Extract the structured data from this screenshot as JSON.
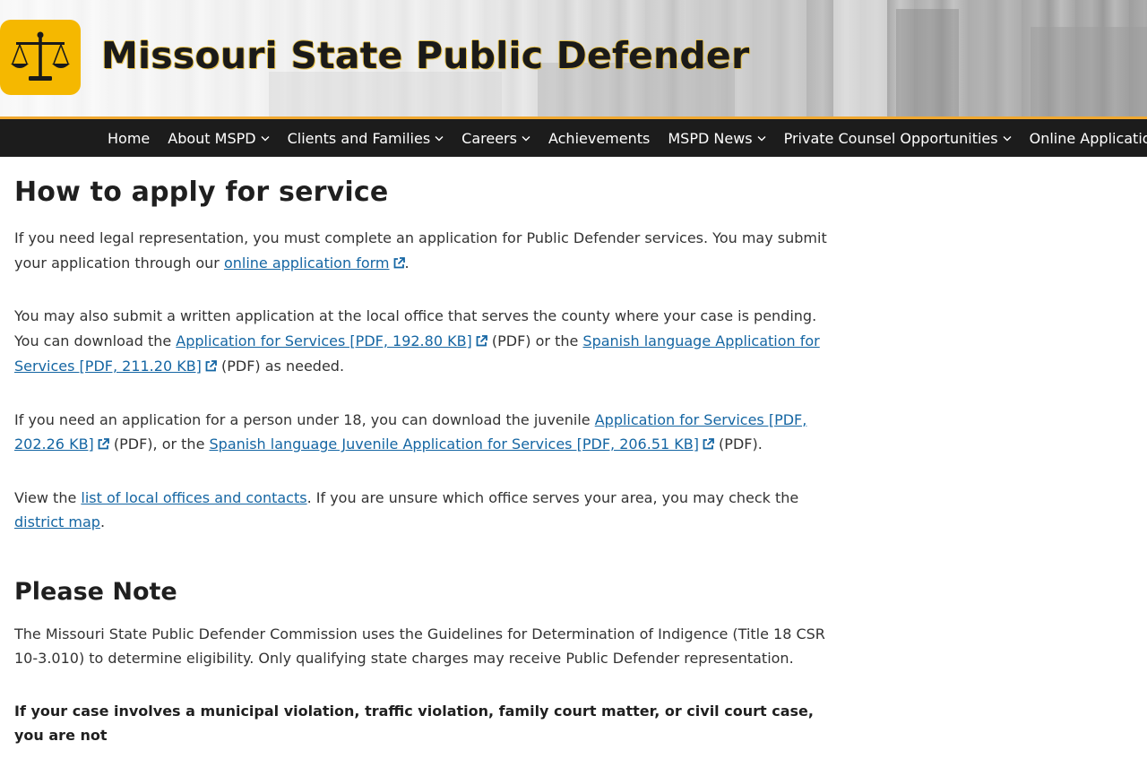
{
  "header": {
    "site_title": "Missouri State Public Defender",
    "brand_color": "#f5b800",
    "accent_color": "#f0a830",
    "logo_icon": "scales-of-justice-icon"
  },
  "nav": {
    "items": [
      {
        "label": "Home",
        "has_dropdown": false
      },
      {
        "label": "About MSPD",
        "has_dropdown": true
      },
      {
        "label": "Clients and Families",
        "has_dropdown": true
      },
      {
        "label": "Careers",
        "has_dropdown": true
      },
      {
        "label": "Achievements",
        "has_dropdown": false
      },
      {
        "label": "MSPD News",
        "has_dropdown": true
      },
      {
        "label": "Private Counsel Opportunities",
        "has_dropdown": true
      },
      {
        "label": "Online Application",
        "has_dropdown": false
      }
    ]
  },
  "main": {
    "heading": "How to apply for service",
    "p1": {
      "text1": "If you need legal representation, you must complete an application for Public Defender services. You may submit your application through our ",
      "link1": "online application form",
      "text2": "."
    },
    "p2": {
      "text1": "You may also submit a written application at the local office that serves the county where your case is pending. You can download the ",
      "link1": "Application for Services [PDF, 192.80 KB]",
      "text2": " (PDF) or the ",
      "link2": "Spanish language Application for Services [PDF, 211.20 KB]",
      "text3": " (PDF) as needed."
    },
    "p3": {
      "text1": "If you need an application for a person under 18, you can download the juvenile ",
      "link1": "Application for Services [PDF, 202.26 KB]",
      "text2": " (PDF), or the ",
      "link2": "Spanish language Juvenile Application for Services [PDF, 206.51 KB]",
      "text3": " (PDF)."
    },
    "p4": {
      "text1": "View the ",
      "link1": "list of local offices and contacts",
      "text2": ". If you are unsure which office serves your area, you may check the ",
      "link2": "district map",
      "text3": "."
    },
    "note_heading": "Please Note",
    "p5": "The Missouri State Public Defender Commission uses the Guidelines for Determination of Indigence (Title 18 CSR 10-3.010) to determine eligibility. Only qualifying state charges may receive Public Defender representation.",
    "p6_bold": "If your case involves a municipal violation, traffic violation, family court matter, or civil court case, you are not"
  }
}
